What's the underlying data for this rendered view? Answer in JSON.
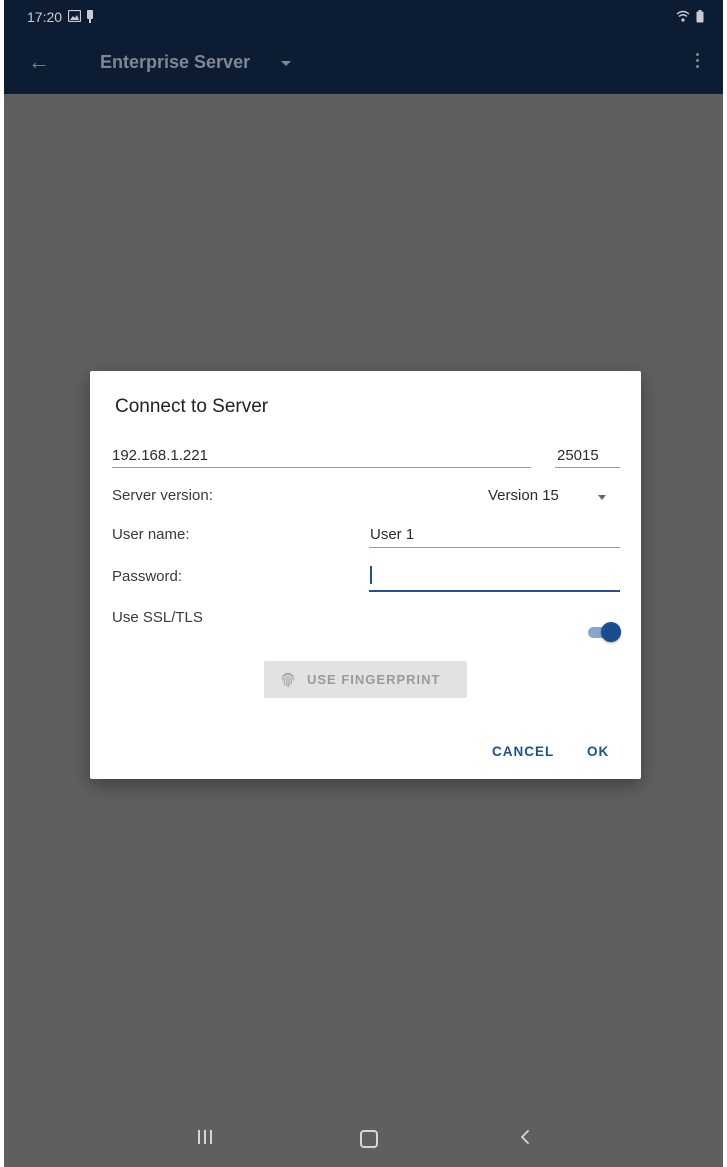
{
  "status_bar": {
    "time": "17:20",
    "left_icons": [
      "gallery-icon",
      "notification-icon"
    ],
    "right_icons": [
      "wifi-icon",
      "battery-icon"
    ]
  },
  "app_bar": {
    "back_icon": "arrow-left-icon",
    "title": "Enterprise Server",
    "dropdown_icon": "caret-down-icon",
    "overflow_icon": "more-vertical-icon",
    "color": "#0c1d33"
  },
  "dialog": {
    "title": "Connect to Server",
    "host": {
      "value": "192.168.1.221"
    },
    "port": {
      "value": "25015"
    },
    "server_version": {
      "label": "Server version:",
      "selected": "Version 15"
    },
    "user_name": {
      "label": "User name:",
      "value": "User 1"
    },
    "password": {
      "label": "Password:",
      "value": ""
    },
    "ssl": {
      "label": "Use SSL/TLS",
      "enabled": true
    },
    "fingerprint_button": {
      "label": "USE FINGERPRINT",
      "icon": "fingerprint-icon",
      "enabled": false
    },
    "actions": {
      "cancel": "CANCEL",
      "ok": "OK"
    },
    "accent_color": "#1f5196"
  },
  "nav_bar": {
    "icons": [
      "recent-apps-icon",
      "home-icon",
      "back-icon"
    ]
  }
}
